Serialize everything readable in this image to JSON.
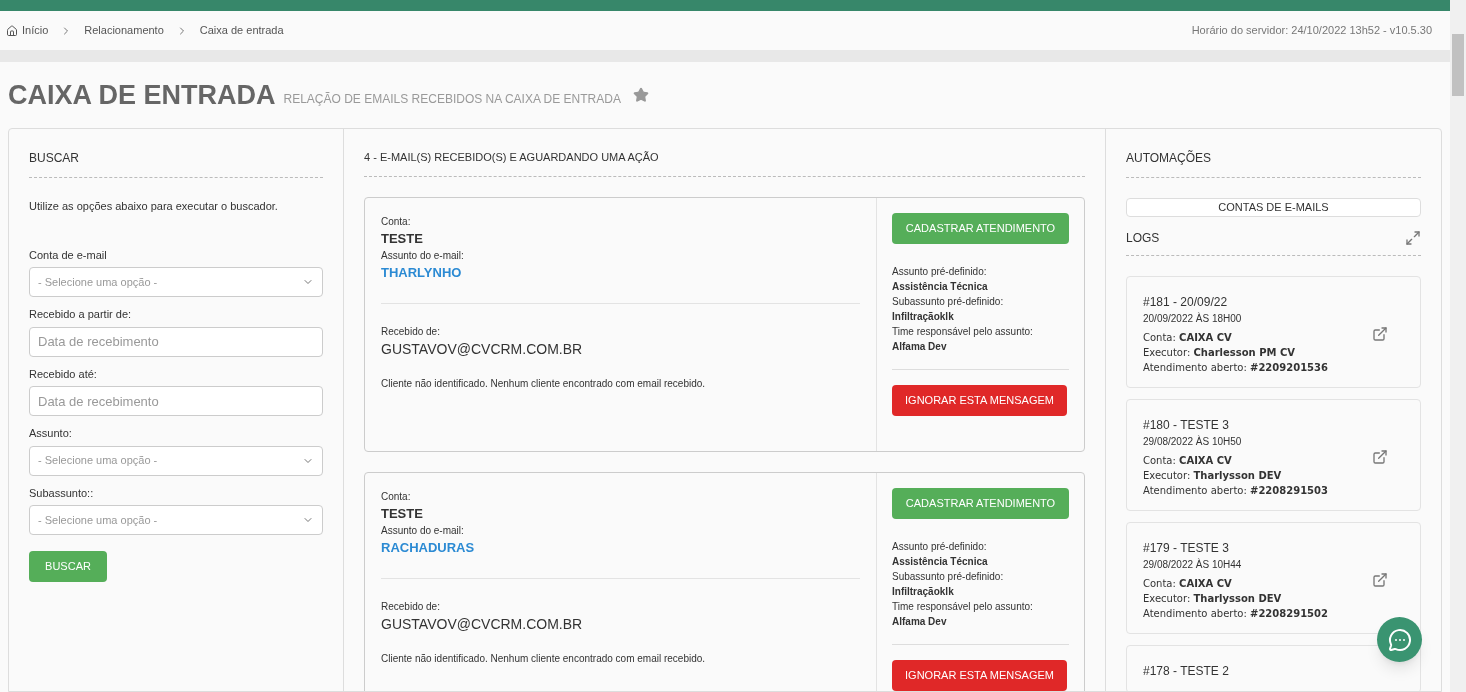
{
  "breadcrumb": {
    "items": [
      {
        "label": "Início",
        "kind": "home"
      },
      {
        "label": "Relacionamento",
        "kind": "link"
      },
      {
        "label": "Caixa de entrada",
        "kind": "link"
      }
    ],
    "server_time": "Horário do servidor: 24/10/2022 13h52 - v10.5.30"
  },
  "page": {
    "title": "CAIXA DE ENTRADA",
    "subtitle": "RELAÇÃO DE EMAILS RECEBIDOS NA CAIXA DE ENTRADA"
  },
  "search": {
    "heading": "BUSCAR",
    "hint": "Utilize as opções abaixo para executar o buscador.",
    "fields": [
      {
        "kind": "select",
        "label": "Conta de e-mail",
        "placeholder": "- Selecione uma opção -"
      },
      {
        "kind": "input",
        "label": "Recebido a partir de:",
        "placeholder": "Data de recebimento"
      },
      {
        "kind": "input",
        "label": "Recebido até:",
        "placeholder": "Data de recebimento"
      },
      {
        "kind": "select",
        "label": "Assunto:",
        "placeholder": "- Selecione uma opção -"
      },
      {
        "kind": "select",
        "label": "Subassunto::",
        "placeholder": "- Selecione uma opção -"
      }
    ],
    "button": "BUSCAR"
  },
  "emails": {
    "heading": "4 - E-MAIL(S) RECEBIDO(S) E AGUARDANDO UMA AÇÃO",
    "items": [
      {
        "account_label": "Conta:",
        "account": "TESTE",
        "subject_label": "Assunto do e-mail:",
        "subject": "THARLYNHO",
        "from_label": "Recebido de:",
        "from": "GUSTAVOV@CVCRM.COM.BR",
        "note": "Cliente não identificado. Nenhum cliente encontrado com email recebido.",
        "register_button": "CADASTRAR ATENDIMENTO",
        "details": [
          {
            "label": "Assunto pré-definido:",
            "value": "Assistência Técnica"
          },
          {
            "label": "Subassunto pré-definido:",
            "value": "Infiltraçãoklk"
          },
          {
            "label": "Time responsável pelo assunto:",
            "value": "Alfama Dev"
          }
        ],
        "ignore_button": "IGNORAR ESTA MENSAGEM"
      },
      {
        "account_label": "Conta:",
        "account": "TESTE",
        "subject_label": "Assunto do e-mail:",
        "subject": "RACHADURAS",
        "from_label": "Recebido de:",
        "from": "GUSTAVOV@CVCRM.COM.BR",
        "note": "Cliente não identificado. Nenhum cliente encontrado com email recebido.",
        "register_button": "CADASTRAR ATENDIMENTO",
        "details": [
          {
            "label": "Assunto pré-definido:",
            "value": "Assistência Técnica"
          },
          {
            "label": "Subassunto pré-definido:",
            "value": "Infiltraçãoklk"
          },
          {
            "label": "Time responsável pelo assunto:",
            "value": "Alfama Dev"
          }
        ],
        "ignore_button": "IGNORAR ESTA MENSAGEM"
      }
    ]
  },
  "automations": {
    "heading": "AUTOMAÇÕES",
    "accounts_button": "CONTAS DE E-MAILS",
    "logs_heading": "LOGS",
    "logs": [
      {
        "title": "#181 - 20/09/22",
        "date": "20/09/2022 ÀS 18H00",
        "lines": [
          {
            "label": "Conta:",
            "value": "CAIXA CV"
          },
          {
            "label": "Executor:",
            "value": "Charlesson PM CV"
          },
          {
            "label": "Atendimento aberto:",
            "value": "#2209201536"
          }
        ]
      },
      {
        "title": "#180 - TESTE 3",
        "date": "29/08/2022 ÀS 10H50",
        "lines": [
          {
            "label": "Conta:",
            "value": "CAIXA CV"
          },
          {
            "label": "Executor:",
            "value": "Tharlysson DEV"
          },
          {
            "label": "Atendimento aberto:",
            "value": "#2208291503"
          }
        ]
      },
      {
        "title": "#179 - TESTE 3",
        "date": "29/08/2022 ÀS 10H44",
        "lines": [
          {
            "label": "Conta:",
            "value": "CAIXA CV"
          },
          {
            "label": "Executor:",
            "value": "Tharlysson DEV"
          },
          {
            "label": "Atendimento aberto:",
            "value": "#2208291502"
          }
        ]
      },
      {
        "title": "#178 - TESTE 2"
      }
    ]
  }
}
